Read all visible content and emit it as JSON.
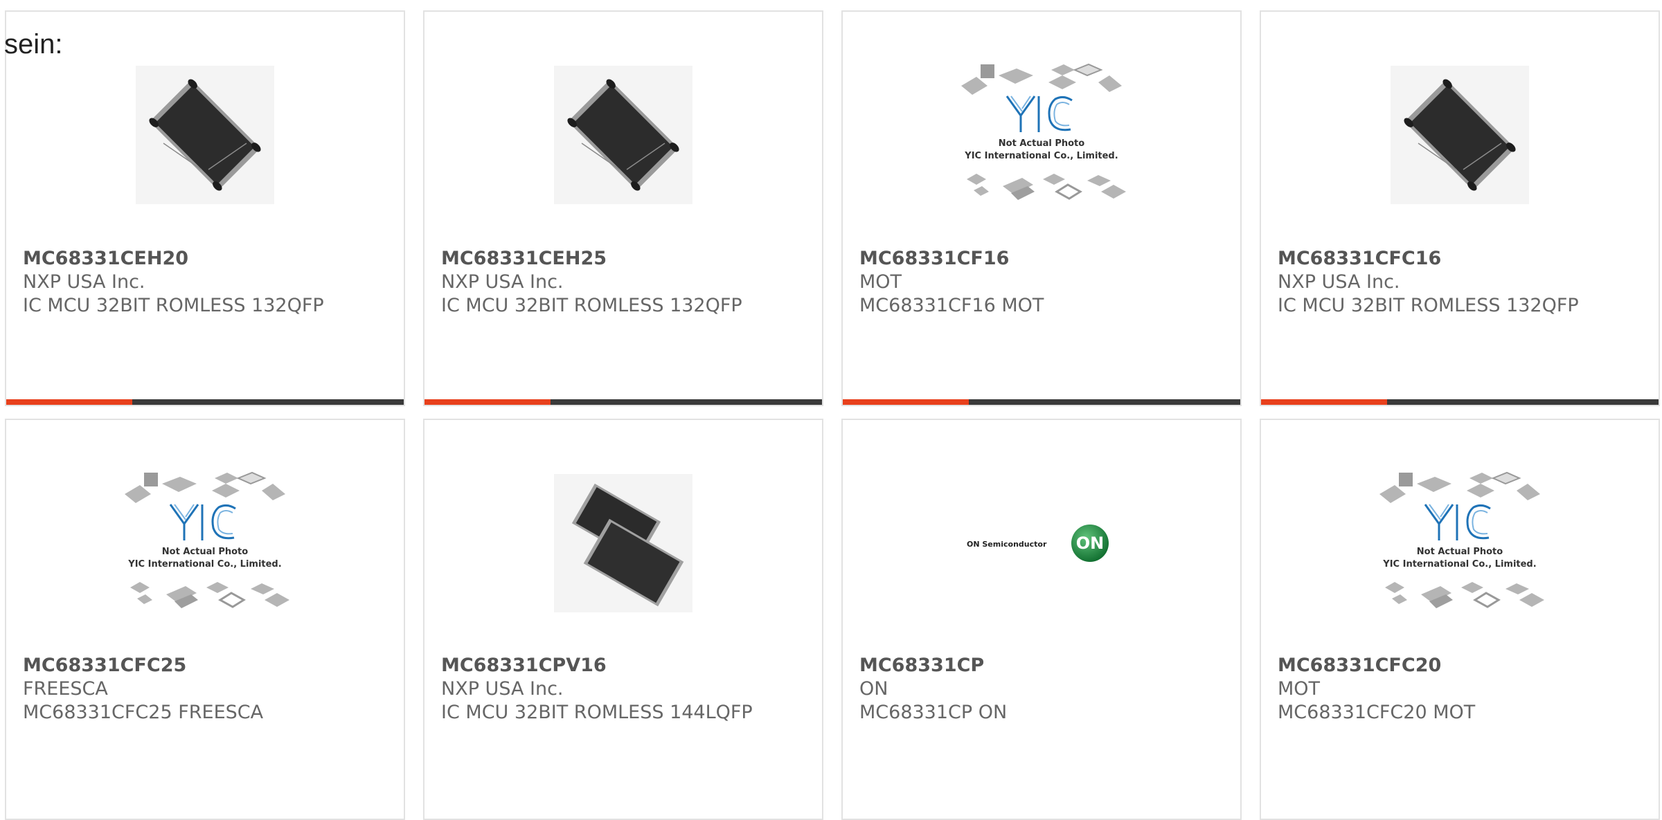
{
  "intro_text": "sein:",
  "colors": {
    "accent": "#e8401c",
    "bar": "#3a3a3a",
    "border": "#e2e2e2",
    "text": "#666666"
  },
  "products": [
    {
      "part_number": "MC68331CEH20",
      "manufacturer": "NXP USA Inc.",
      "description": "IC MCU 32BIT ROMLESS 132QFP",
      "image": "qfp-chip-photo"
    },
    {
      "part_number": "MC68331CEH25",
      "manufacturer": "NXP USA Inc.",
      "description": "IC MCU 32BIT ROMLESS 132QFP",
      "image": "qfp-chip-photo"
    },
    {
      "part_number": "MC68331CF16",
      "manufacturer": "MOT",
      "description": "MC68331CF16 MOT",
      "image": "yic-placeholder",
      "image_text_1": "Not Actual Photo",
      "image_text_2": "YIC International Co., Limited."
    },
    {
      "part_number": "MC68331CFC16",
      "manufacturer": "NXP USA Inc.",
      "description": "IC MCU 32BIT ROMLESS 132QFP",
      "image": "qfp-chip-photo"
    },
    {
      "part_number": "MC68331CFC25",
      "manufacturer": "FREESCA",
      "description": "MC68331CFC25 FREESCA",
      "image": "yic-placeholder",
      "image_text_1": "Not Actual Photo",
      "image_text_2": "YIC International Co., Limited."
    },
    {
      "part_number": "MC68331CPV16",
      "manufacturer": "NXP USA Inc.",
      "description": "IC MCU 32BIT ROMLESS 144LQFP",
      "image": "lqfp-chips-photo"
    },
    {
      "part_number": "MC68331CP",
      "manufacturer": "ON",
      "description": "MC68331CP ON",
      "image": "on-semiconductor-logo",
      "logo_text": "ON Semiconductor",
      "logo_mark": "ON"
    },
    {
      "part_number": "MC68331CFC20",
      "manufacturer": "MOT",
      "description": "MC68331CFC20 MOT",
      "image": "yic-placeholder",
      "image_text_1": "Not Actual Photo",
      "image_text_2": "YIC International Co., Limited."
    }
  ]
}
